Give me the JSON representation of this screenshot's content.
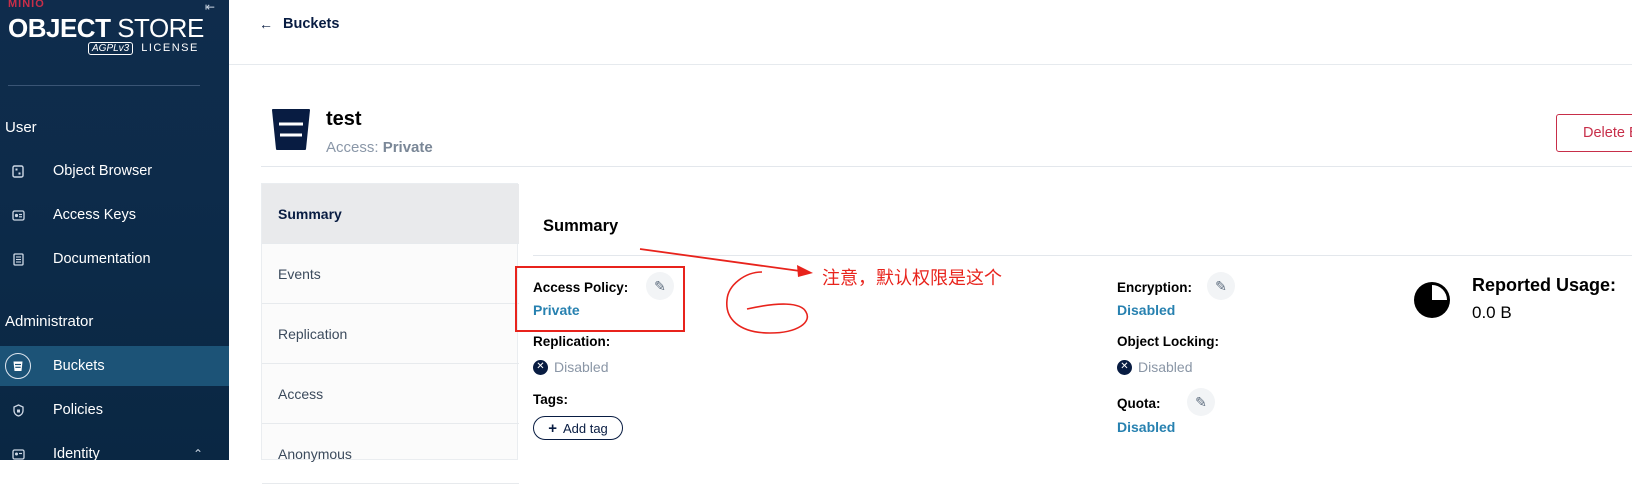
{
  "sidebar": {
    "brand": {
      "minio": "MINIO",
      "title_bold": "OBJECT",
      "title_light": " STORE",
      "agpl": "AGPLv3",
      "license": "LICENSE"
    },
    "user_section": "User",
    "user_items": [
      {
        "label": "Object Browser",
        "icon": "object-browser-icon"
      },
      {
        "label": "Access Keys",
        "icon": "access-keys-icon"
      },
      {
        "label": "Documentation",
        "icon": "documentation-icon"
      }
    ],
    "admin_section": "Administrator",
    "admin_items": [
      {
        "label": "Buckets",
        "icon": "bucket-icon",
        "active": true
      },
      {
        "label": "Policies",
        "icon": "policy-icon"
      },
      {
        "label": "Identity",
        "icon": "identity-icon"
      }
    ]
  },
  "topbar": {
    "back_label": "Buckets"
  },
  "bucket": {
    "name": "test",
    "access_label": "Access:",
    "access_value": "Private",
    "delete_label": "Delete Bucket"
  },
  "tabs": [
    "Summary",
    "Events",
    "Replication",
    "Access",
    "Anonymous"
  ],
  "summary": {
    "title": "Summary",
    "access_policy_label": "Access Policy:",
    "access_policy_value": "Private",
    "replication_label": "Replication:",
    "replication_value": "Disabled",
    "tags_label": "Tags:",
    "add_tag_label": "Add tag",
    "encryption_label": "Encryption:",
    "encryption_value": "Disabled",
    "object_locking_label": "Object Locking:",
    "object_locking_value": "Disabled",
    "quota_label": "Quota:",
    "quota_value": "Disabled",
    "reported_usage_label": "Reported Usage:",
    "reported_usage_value": "0.0 B"
  },
  "annotation": {
    "text": "注意，默认权限是这个",
    "color": "#e8231c"
  },
  "colors": {
    "sidebar_bg": "#0f2c4c",
    "active_nav": "#1c5377",
    "link": "#2781b0",
    "danger": "#c72e49"
  }
}
